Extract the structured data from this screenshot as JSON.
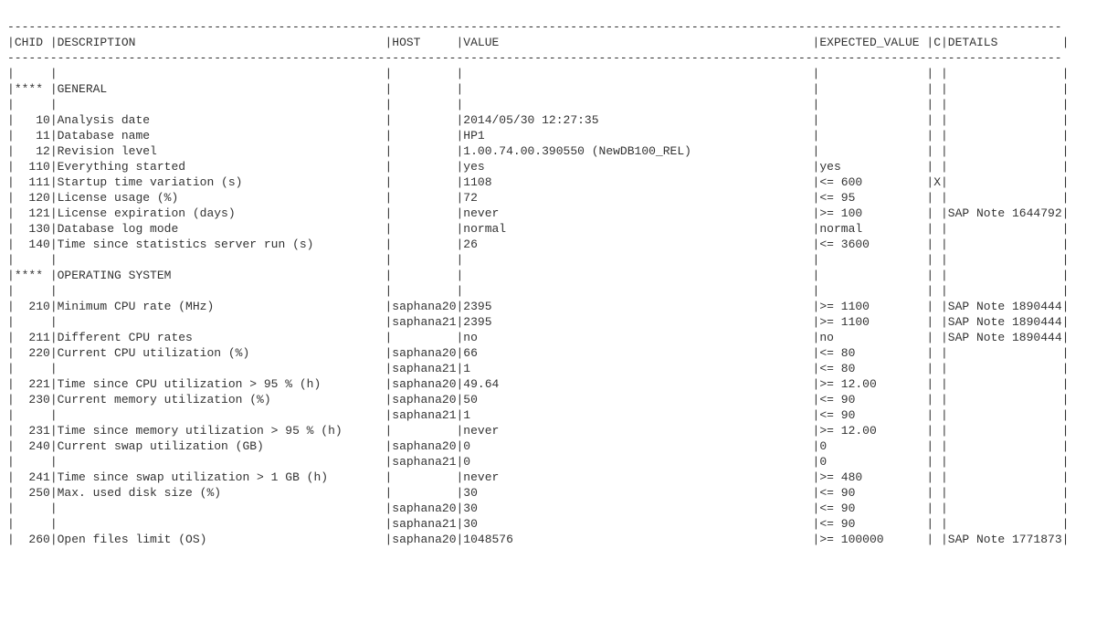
{
  "dash_width": 148,
  "columns": [
    {
      "key": "chid",
      "label": "CHID",
      "cls": "c-chid",
      "header_align": "left"
    },
    {
      "key": "desc",
      "label": "DESCRIPTION",
      "cls": "c-desc"
    },
    {
      "key": "host",
      "label": "HOST",
      "cls": "c-host"
    },
    {
      "key": "value",
      "label": "VALUE",
      "cls": "c-val"
    },
    {
      "key": "exp",
      "label": "EXPECTED_VALUE",
      "cls": "c-exp"
    },
    {
      "key": "c",
      "label": "C",
      "cls": "c-c"
    },
    {
      "key": "det",
      "label": "DETAILS",
      "cls": "c-det"
    }
  ],
  "rows": [
    {
      "type": "blank"
    },
    {
      "type": "section",
      "chid": "****",
      "desc": "GENERAL"
    },
    {
      "type": "blank"
    },
    {
      "type": "data",
      "chid": "10",
      "desc": "Analysis date",
      "host": "",
      "value": "2014/05/30 12:27:35",
      "exp": "",
      "c": "",
      "det": ""
    },
    {
      "type": "data",
      "chid": "11",
      "desc": "Database name",
      "host": "",
      "value": "HP1",
      "exp": "",
      "c": "",
      "det": ""
    },
    {
      "type": "data",
      "chid": "12",
      "desc": "Revision level",
      "host": "",
      "value": "1.00.74.00.390550 (NewDB100_REL)",
      "exp": "",
      "c": "",
      "det": ""
    },
    {
      "type": "data",
      "chid": "110",
      "desc": "Everything started",
      "host": "",
      "value": "yes",
      "exp": "yes",
      "c": "",
      "det": ""
    },
    {
      "type": "data",
      "chid": "111",
      "desc": "Startup time variation (s)",
      "host": "",
      "value": "1108",
      "exp": "<= 600",
      "c": "X",
      "det": ""
    },
    {
      "type": "data",
      "chid": "120",
      "desc": "License usage (%)",
      "host": "",
      "value": "72",
      "exp": "<= 95",
      "c": "",
      "det": ""
    },
    {
      "type": "data",
      "chid": "121",
      "desc": "License expiration (days)",
      "host": "",
      "value": "never",
      "exp": ">= 100",
      "c": "",
      "det": "SAP Note 1644792"
    },
    {
      "type": "data",
      "chid": "130",
      "desc": "Database log mode",
      "host": "",
      "value": "normal",
      "exp": "normal",
      "c": "",
      "det": ""
    },
    {
      "type": "data",
      "chid": "140",
      "desc": "Time since statistics server run (s)",
      "host": "",
      "value": "26",
      "exp": "<= 3600",
      "c": "",
      "det": ""
    },
    {
      "type": "blank"
    },
    {
      "type": "section",
      "chid": "****",
      "desc": "OPERATING SYSTEM"
    },
    {
      "type": "blank"
    },
    {
      "type": "data",
      "chid": "210",
      "desc": "Minimum CPU rate (MHz)",
      "host": "saphana20",
      "value": "2395",
      "exp": ">= 1100",
      "c": "",
      "det": "SAP Note 1890444"
    },
    {
      "type": "data",
      "chid": "",
      "desc": "",
      "host": "saphana21",
      "value": "2395",
      "exp": ">= 1100",
      "c": "",
      "det": "SAP Note 1890444"
    },
    {
      "type": "data",
      "chid": "211",
      "desc": "Different CPU rates",
      "host": "",
      "value": "no",
      "exp": "no",
      "c": "",
      "det": "SAP Note 1890444"
    },
    {
      "type": "data",
      "chid": "220",
      "desc": "Current CPU utilization (%)",
      "host": "saphana20",
      "value": "66",
      "exp": "<= 80",
      "c": "",
      "det": ""
    },
    {
      "type": "data",
      "chid": "",
      "desc": "",
      "host": "saphana21",
      "value": "1",
      "exp": "<= 80",
      "c": "",
      "det": ""
    },
    {
      "type": "data",
      "chid": "221",
      "desc": "Time since CPU utilization > 95 % (h)",
      "host": "saphana20",
      "value": "49.64",
      "exp": ">= 12.00",
      "c": "",
      "det": ""
    },
    {
      "type": "data",
      "chid": "230",
      "desc": "Current memory utilization (%)",
      "host": "saphana20",
      "value": "50",
      "exp": "<= 90",
      "c": "",
      "det": ""
    },
    {
      "type": "data",
      "chid": "",
      "desc": "",
      "host": "saphana21",
      "value": "1",
      "exp": "<= 90",
      "c": "",
      "det": ""
    },
    {
      "type": "data",
      "chid": "231",
      "desc": "Time since memory utilization > 95 % (h)",
      "host": "",
      "value": "never",
      "exp": ">= 12.00",
      "c": "",
      "det": ""
    },
    {
      "type": "data",
      "chid": "240",
      "desc": "Current swap utilization (GB)",
      "host": "saphana20",
      "value": "0",
      "exp": "0",
      "c": "",
      "det": ""
    },
    {
      "type": "data",
      "chid": "",
      "desc": "",
      "host": "saphana21",
      "value": "0",
      "exp": "0",
      "c": "",
      "det": ""
    },
    {
      "type": "data",
      "chid": "241",
      "desc": "Time since swap utilization > 1 GB (h)",
      "host": "",
      "value": "never",
      "exp": ">= 480",
      "c": "",
      "det": ""
    },
    {
      "type": "data",
      "chid": "250",
      "desc": "Max. used disk size (%)",
      "host": "",
      "value": "30",
      "exp": "<= 90",
      "c": "",
      "det": ""
    },
    {
      "type": "data",
      "chid": "",
      "desc": "",
      "host": "saphana20",
      "value": "30",
      "exp": "<= 90",
      "c": "",
      "det": ""
    },
    {
      "type": "data",
      "chid": "",
      "desc": "",
      "host": "saphana21",
      "value": "30",
      "exp": "<= 90",
      "c": "",
      "det": ""
    },
    {
      "type": "data",
      "chid": "260",
      "desc": "Open files limit (OS)",
      "host": "saphana20",
      "value": "1048576",
      "exp": ">= 100000",
      "c": "",
      "det": "SAP Note 1771873"
    }
  ]
}
